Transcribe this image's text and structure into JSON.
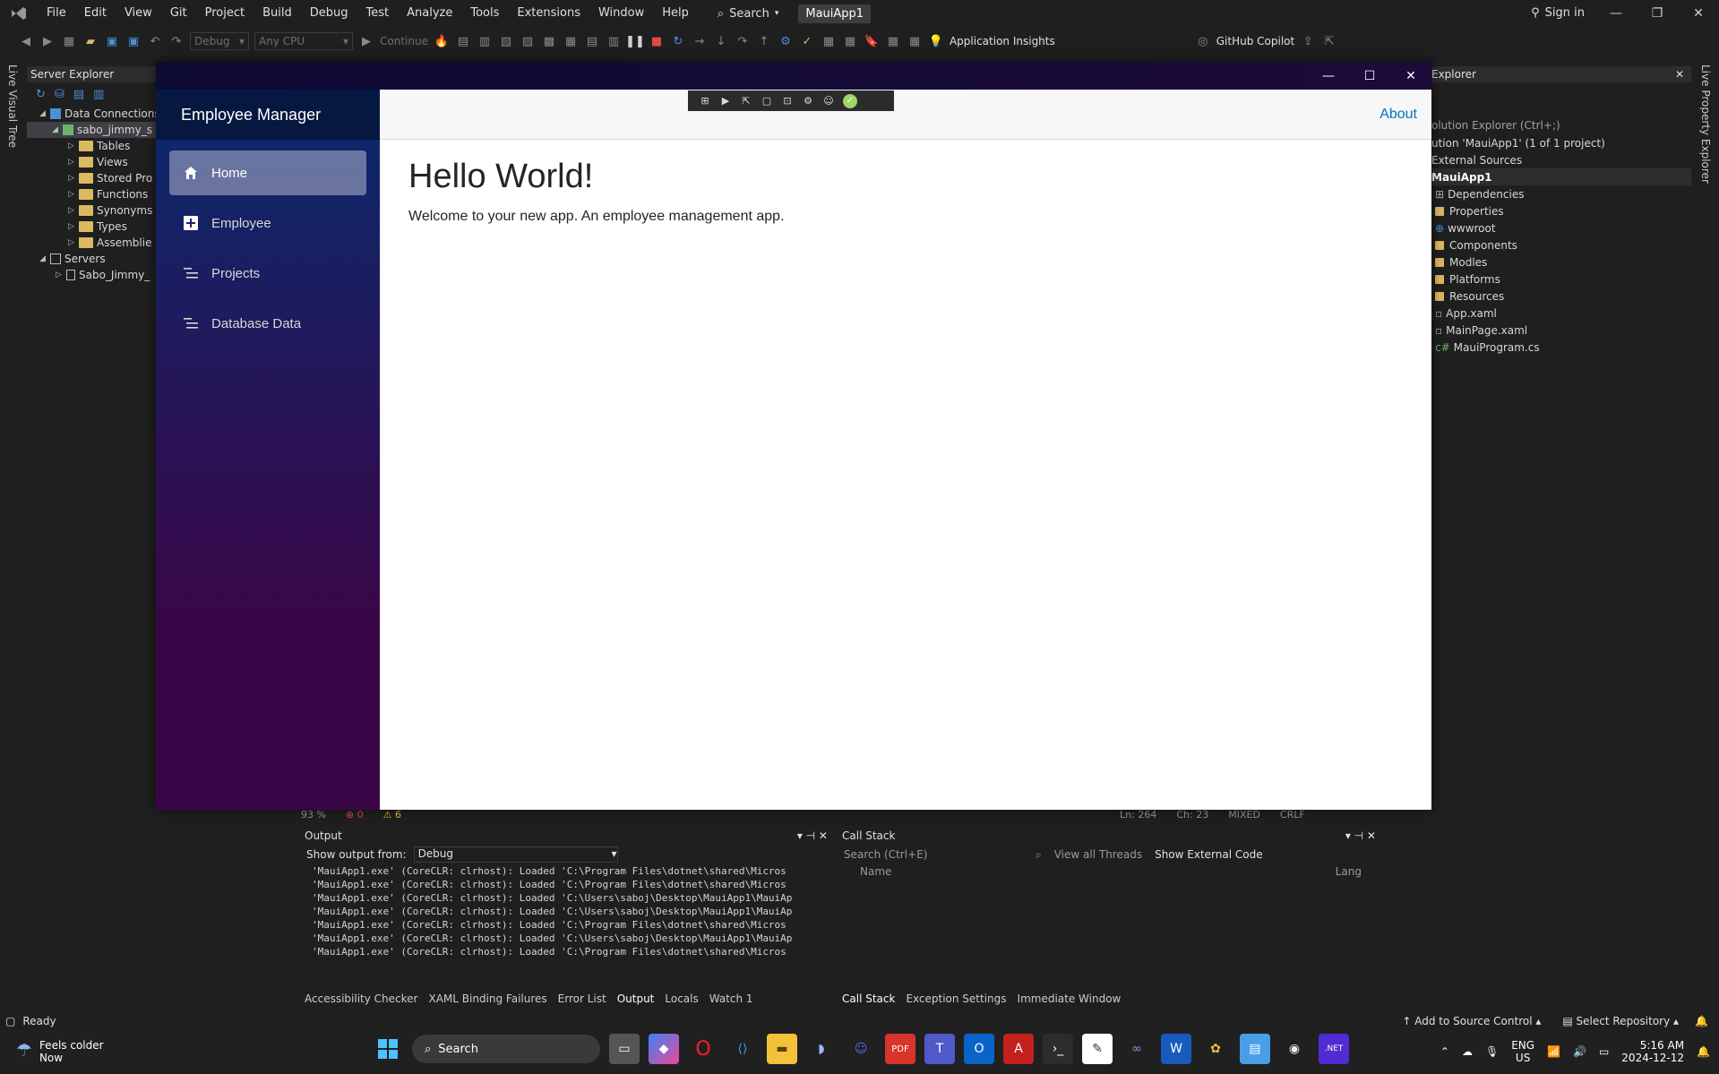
{
  "vs": {
    "menu": [
      "File",
      "Edit",
      "View",
      "Git",
      "Project",
      "Build",
      "Debug",
      "Test",
      "Analyze",
      "Tools",
      "Extensions",
      "Window",
      "Help"
    ],
    "search_label": "Search",
    "solution_name": "MauiApp1",
    "sign_in": "Sign in",
    "toolbar": {
      "config": "Debug",
      "platform": "Any CPU",
      "continue": "Continue",
      "app_insights": "Application Insights",
      "copilot": "GitHub Copilot"
    },
    "live_visual_tree": "Live Visual Tree",
    "live_property_explorer": "Live Property Explorer"
  },
  "server_explorer": {
    "title": "Server Explorer",
    "items": [
      {
        "label": "Data Connections",
        "indent": 0
      },
      {
        "label": "sabo_jimmy_s",
        "indent": 1
      },
      {
        "label": "Tables",
        "indent": 2
      },
      {
        "label": "Views",
        "indent": 2
      },
      {
        "label": "Stored Pro",
        "indent": 2
      },
      {
        "label": "Functions",
        "indent": 2
      },
      {
        "label": "Synonyms",
        "indent": 2
      },
      {
        "label": "Types",
        "indent": 2
      },
      {
        "label": "Assemblie",
        "indent": 2
      },
      {
        "label": "Servers",
        "indent": 0
      },
      {
        "label": "Sabo_Jimmy_",
        "indent": 1
      }
    ]
  },
  "solution_explorer": {
    "title": "Explorer",
    "search_placeholder": "olution Explorer (Ctrl+;)",
    "solution_line": "ution 'MauiApp1' (1 of 1 project)",
    "items": [
      {
        "label": "External Sources"
      },
      {
        "label": "MauiApp1"
      },
      {
        "label": "Dependencies"
      },
      {
        "label": "Properties"
      },
      {
        "label": "wwwroot"
      },
      {
        "label": "Components"
      },
      {
        "label": "Modles"
      },
      {
        "label": "Platforms"
      },
      {
        "label": "Resources"
      },
      {
        "label": "App.xaml"
      },
      {
        "label": "MainPage.xaml"
      },
      {
        "label": "MauiProgram.cs"
      }
    ]
  },
  "editor_status": {
    "zoom": "93 %",
    "errors": "0",
    "warnings": "6",
    "line": "Ln: 264",
    "col": "Ch: 23",
    "mode": "MIXED",
    "eol": "CRLF"
  },
  "output": {
    "title": "Output",
    "show_from_label": "Show output from:",
    "show_from_value": "Debug",
    "lines": [
      "'MauiApp1.exe' (CoreCLR: clrhost): Loaded 'C:\\Program Files\\dotnet\\shared\\Micros",
      "'MauiApp1.exe' (CoreCLR: clrhost): Loaded 'C:\\Program Files\\dotnet\\shared\\Micros",
      "'MauiApp1.exe' (CoreCLR: clrhost): Loaded 'C:\\Users\\saboj\\Desktop\\MauiApp1\\MauiAp",
      "'MauiApp1.exe' (CoreCLR: clrhost): Loaded 'C:\\Users\\saboj\\Desktop\\MauiApp1\\MauiAp",
      "'MauiApp1.exe' (CoreCLR: clrhost): Loaded 'C:\\Program Files\\dotnet\\shared\\Micros",
      "'MauiApp1.exe' (CoreCLR: clrhost): Loaded 'C:\\Users\\saboj\\Desktop\\MauiApp1\\MauiAp",
      "'MauiApp1.exe' (CoreCLR: clrhost): Loaded 'C:\\Program Files\\dotnet\\shared\\Micros"
    ],
    "tabs": [
      "Accessibility Checker",
      "XAML Binding Failures",
      "Error List",
      "Output",
      "Locals",
      "Watch 1"
    ]
  },
  "call_stack": {
    "title": "Call Stack",
    "search_placeholder": "Search (Ctrl+E)",
    "view_all_threads": "View all Threads",
    "show_external_code": "Show External Code",
    "col_name": "Name",
    "col_lang": "Lang",
    "tabs": [
      "Call Stack",
      "Exception Settings",
      "Immediate Window"
    ]
  },
  "status_bar": {
    "ready": "Ready",
    "add_source_control": "Add to Source Control",
    "select_repo": "Select Repository"
  },
  "taskbar": {
    "weather_title": "Feels colder",
    "weather_sub": "Now",
    "search": "Search",
    "lang": "ENG",
    "region": "US",
    "time": "5:16 AM",
    "date": "2024-12-12",
    "dotnet_label": ".NET"
  },
  "app": {
    "brand": "Employee Manager",
    "about": "About",
    "nav": [
      {
        "label": "Home",
        "icon": "home-icon",
        "active": true
      },
      {
        "label": "Employee",
        "icon": "plus-icon",
        "active": false
      },
      {
        "label": "Projects",
        "icon": "list-icon",
        "active": false
      },
      {
        "label": "Database Data",
        "icon": "list-icon",
        "active": false
      }
    ],
    "heading": "Hello World!",
    "body": "Welcome to your new app. An employee management app."
  }
}
